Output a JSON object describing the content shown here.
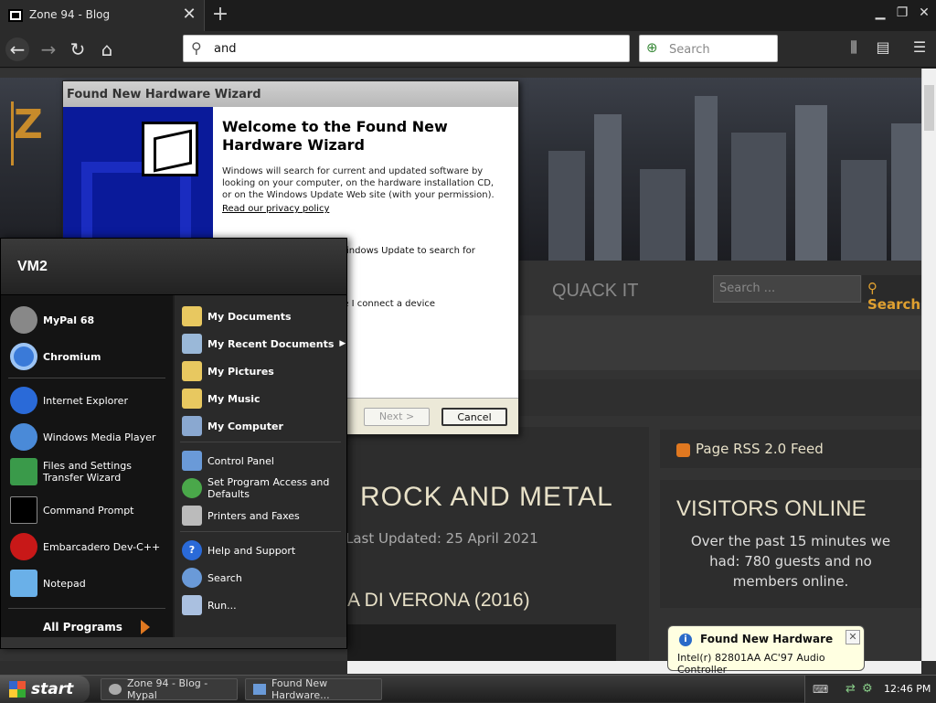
{
  "browser": {
    "tab_title": "Zone 94 - Blog",
    "url": "and",
    "search_placeholder": "Search"
  },
  "page": {
    "nav_item": "QUACK IT",
    "search_placeholder": "Search ...",
    "search_button": "Search",
    "category_title": "ROCK AND METAL",
    "last_updated": "Last Updated: 25 April 2021",
    "post_title": "A DI VERONA (2016)",
    "rss_label": "Page RSS 2.0 Feed",
    "visitors_title": "VISITORS ONLINE",
    "visitors_text": "Over the past 15 minutes we had: 780 guests and no members online."
  },
  "wizard": {
    "title": "Found New Hardware Wizard",
    "heading": "Welcome to the Found New Hardware Wizard",
    "description": "Windows will search for current and updated software by looking on your computer, on the hardware installation CD, or on the Windows Update Web site (with your permission).",
    "privacy_link": "Read our privacy policy",
    "question_fragment_1": "indows Update to search for",
    "question_fragment_2": "ne I connect a device",
    "next_button": "Next >",
    "cancel_button": "Cancel"
  },
  "start_menu": {
    "user": "VM2",
    "left_items": [
      {
        "label": "MyPal 68",
        "bold": true
      },
      {
        "label": "Chromium",
        "bold": true
      },
      {
        "label": "Internet Explorer"
      },
      {
        "label": "Windows Media Player"
      },
      {
        "label": "Files and Settings Transfer Wizard"
      },
      {
        "label": "Command Prompt"
      },
      {
        "label": "Embarcadero Dev-C++"
      },
      {
        "label": "Notepad"
      }
    ],
    "all_programs": "All Programs",
    "right_items": [
      {
        "label": "My Documents"
      },
      {
        "label": "My Recent Documents"
      },
      {
        "label": "My Pictures"
      },
      {
        "label": "My Music"
      },
      {
        "label": "My Computer"
      },
      {
        "label": "Control Panel"
      },
      {
        "label": "Set Program Access and Defaults"
      },
      {
        "label": "Printers and Faxes"
      },
      {
        "label": "Help and Support"
      },
      {
        "label": "Search"
      },
      {
        "label": "Run..."
      }
    ]
  },
  "balloon": {
    "title": "Found New Hardware",
    "text": "Intel(r) 82801AA AC'97 Audio Controller"
  },
  "taskbar": {
    "start_label": "start",
    "tasks": [
      "Zone 94 - Blog - Mypal",
      "Found New Hardware..."
    ],
    "clock": "12:46 PM"
  }
}
